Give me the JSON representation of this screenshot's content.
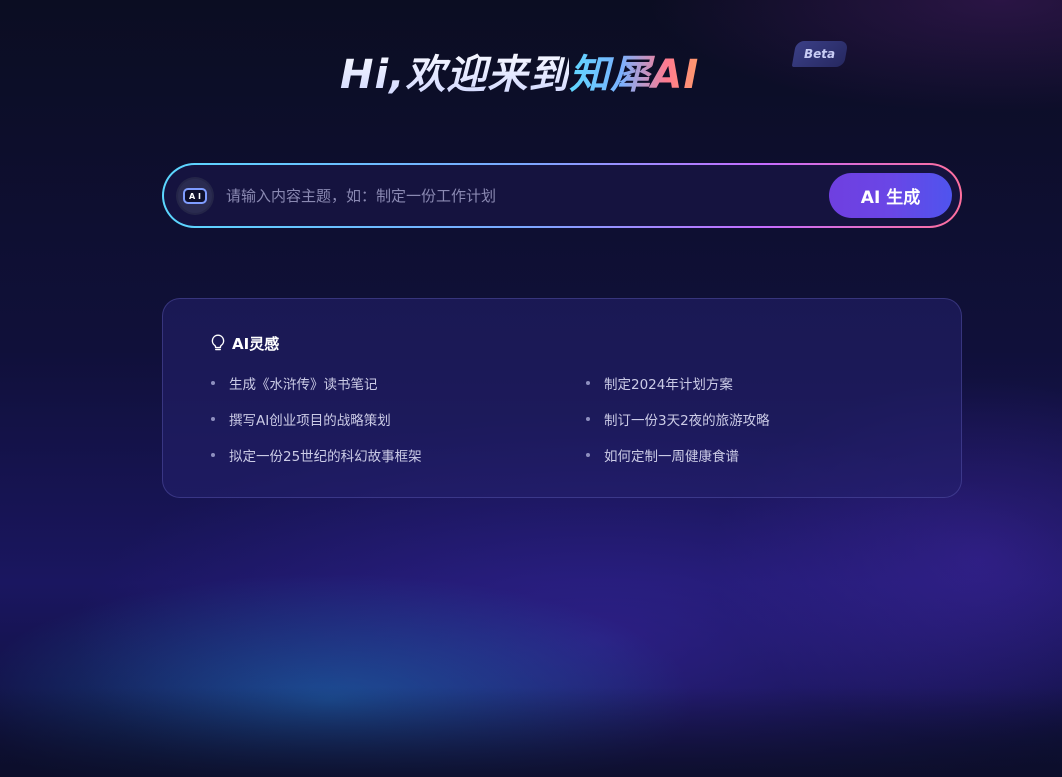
{
  "header": {
    "title_main": "Hi,欢迎来到",
    "title_brand": "知犀AI",
    "badge": "Beta"
  },
  "search": {
    "placeholder": "请输入内容主题，如：制定一份工作计划",
    "value": "",
    "bot_icon_text": "A I",
    "button_label": "AI 生成"
  },
  "inspiration": {
    "title": "AI灵感",
    "icon": "lightbulb-icon",
    "items_left": [
      "生成《水浒传》读书笔记",
      "撰写AI创业项目的战略策划",
      "拟定一份25世纪的科幻故事框架"
    ],
    "items_right": [
      "制定2024年计划方案",
      "制订一份3天2夜的旅游攻略",
      "如何定制一周健康食谱"
    ]
  },
  "colors": {
    "accent_purple": "#6f3fe0",
    "brand_cyan": "#5fd8ff",
    "brand_coral": "#ff7a8f"
  }
}
